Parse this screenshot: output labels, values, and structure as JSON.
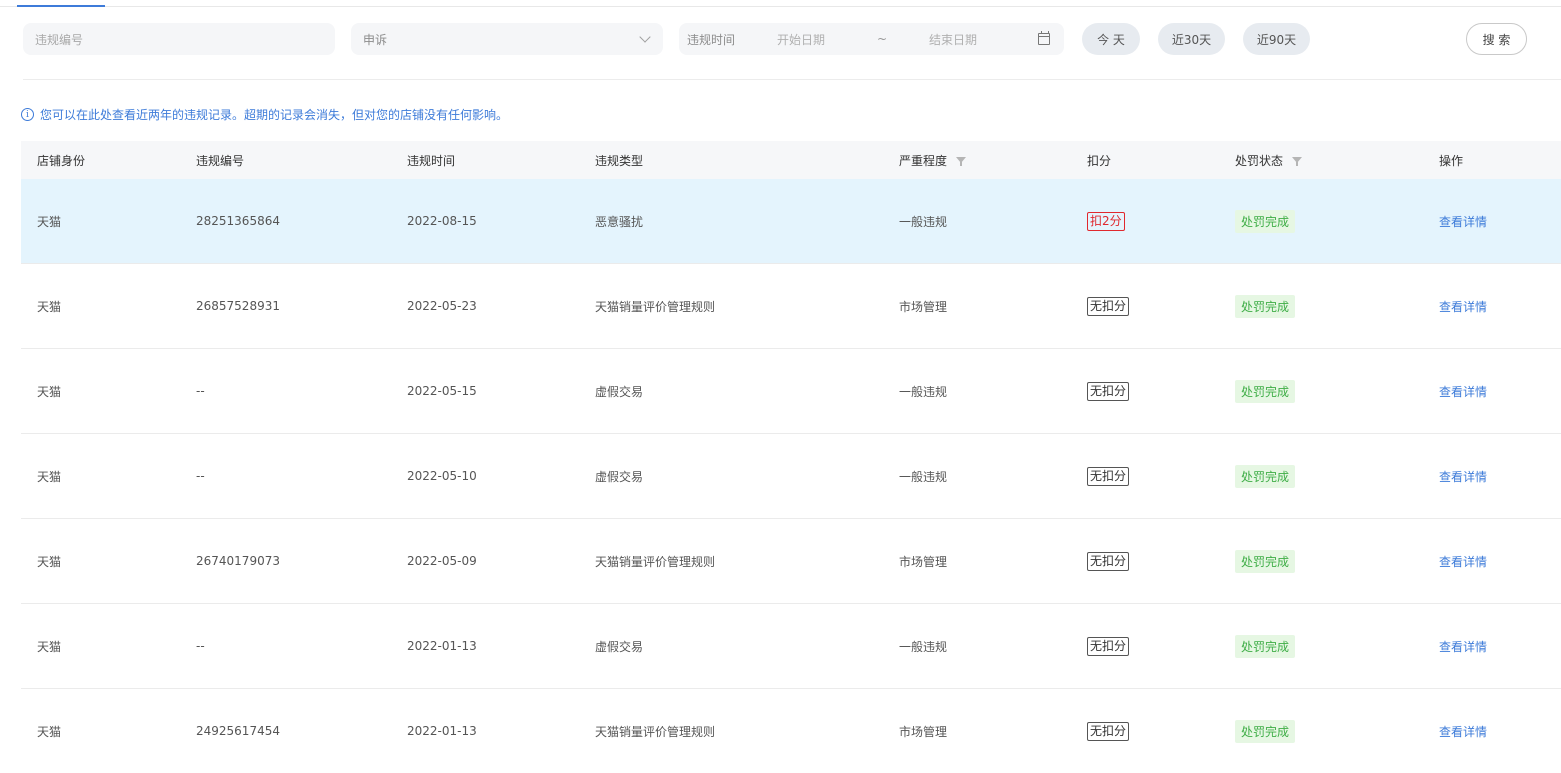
{
  "filters": {
    "violation_id_placeholder": "违规编号",
    "status_select_value": "申诉",
    "date_label": "违规时间",
    "date_start_placeholder": "开始日期",
    "date_separator": "~",
    "date_end_placeholder": "结束日期",
    "quick_today": "今 天",
    "quick_30": "近30天",
    "quick_90": "近90天",
    "search_button": "搜 索"
  },
  "notice": {
    "icon": "i",
    "text": "您可以在此处查看近两年的违规记录。超期的记录会消失，但对您的店铺没有任何影响。"
  },
  "table": {
    "headers": [
      "店铺身份",
      "违规编号",
      "违规时间",
      "违规类型",
      "严重程度",
      "扣分",
      "处罚状态",
      "操作"
    ],
    "rows": [
      {
        "identity": "天猫",
        "id": "28251365864",
        "time": "2022-08-15",
        "type": "恶意骚扰",
        "severity": "一般违规",
        "score": "扣2分",
        "status": "处罚完成",
        "action": "查看详情"
      },
      {
        "identity": "天猫",
        "id": "26857528931",
        "time": "2022-05-23",
        "type": "天猫销量评价管理规则",
        "severity": "市场管理",
        "score": "无扣分",
        "status": "处罚完成",
        "action": "查看详情"
      },
      {
        "identity": "天猫",
        "id": "--",
        "time": "2022-05-15",
        "type": "虚假交易",
        "severity": "一般违规",
        "score": "无扣分",
        "status": "处罚完成",
        "action": "查看详情"
      },
      {
        "identity": "天猫",
        "id": "--",
        "time": "2022-05-10",
        "type": "虚假交易",
        "severity": "一般违规",
        "score": "无扣分",
        "status": "处罚完成",
        "action": "查看详情"
      },
      {
        "identity": "天猫",
        "id": "26740179073",
        "time": "2022-05-09",
        "type": "天猫销量评价管理规则",
        "severity": "市场管理",
        "score": "无扣分",
        "status": "处罚完成",
        "action": "查看详情"
      },
      {
        "identity": "天猫",
        "id": "--",
        "time": "2022-01-13",
        "type": "虚假交易",
        "severity": "一般违规",
        "score": "无扣分",
        "status": "处罚完成",
        "action": "查看详情"
      },
      {
        "identity": "天猫",
        "id": "24925617454",
        "time": "2022-01-13",
        "type": "天猫销量评价管理规则",
        "severity": "市场管理",
        "score": "无扣分",
        "status": "处罚完成",
        "action": "查看详情"
      }
    ]
  },
  "colors": {
    "accent": "#3d7bd9",
    "highlight_row": "#e4f4fd",
    "score_red": "#e0282e",
    "status_green": "#3fae47"
  }
}
